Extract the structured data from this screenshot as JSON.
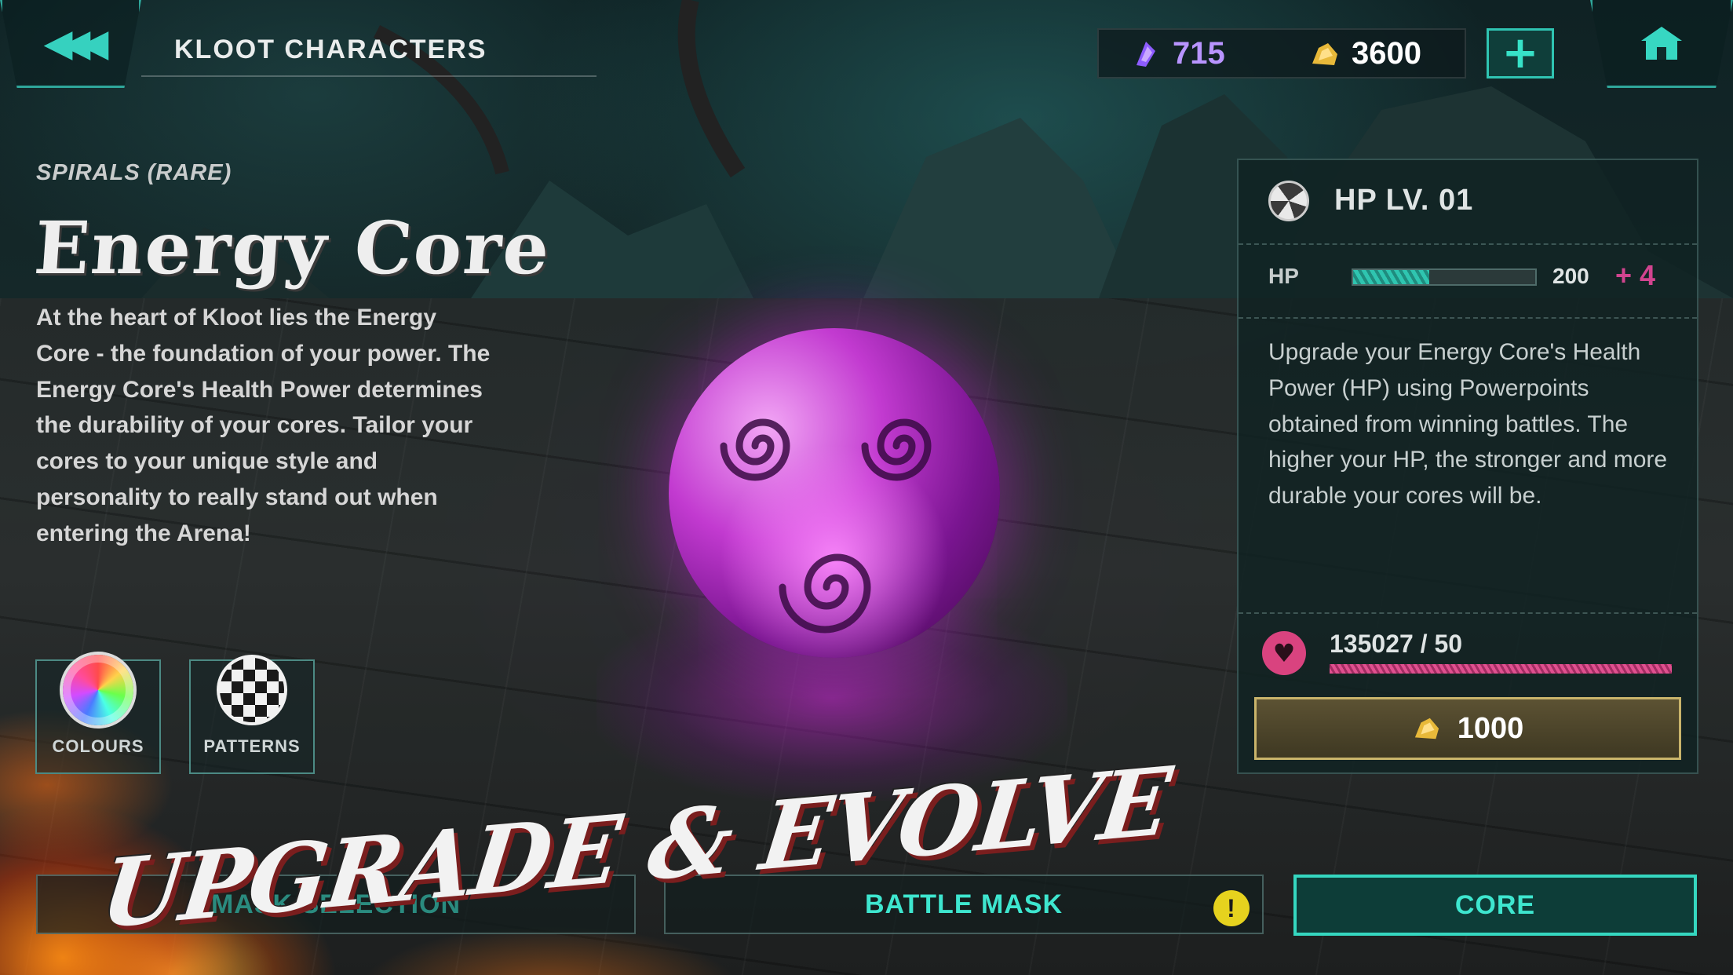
{
  "header": {
    "back_icon": "triple-chevron-left-icon",
    "title": "KLOOT CHARACTERS",
    "gems": "715",
    "gold": "3600",
    "add_icon": "plus-icon",
    "home_icon": "home-icon"
  },
  "item": {
    "rarity": "SPIRALS (RARE)",
    "name": "Energy Core",
    "description": "At the heart of Kloot lies the Energy Core - the foundation of your power. The Energy Core's Health Power determines the durability of your cores. Tailor your cores to your unique style and personality to really stand out when entering the Arena!"
  },
  "tools": [
    {
      "label": "COLOURS",
      "icon": "colour-wheel-icon"
    },
    {
      "label": "PATTERNS",
      "icon": "pattern-ball-icon"
    }
  ],
  "upgrade_panel": {
    "level_title": "HP LV. 01",
    "hp_label": "HP",
    "hp_value": "200",
    "hp_bonus": "+ 4",
    "hp_fill_fraction": 0.42,
    "description": "Upgrade your Energy Core's Health Power (HP) using Powerpoints obtained from winning battles. The higher your HP, the stronger and more durable your cores will be.",
    "powerpoints": "135027 / 50",
    "powerpoints_fill_fraction": 1.0,
    "cost": "1000"
  },
  "tabs": {
    "mask_selection": "MASK SELECTION",
    "battle_mask": "BATTLE MASK",
    "core": "CORE"
  },
  "promo_banner": "UPGRADE & EVOLVE",
  "colors": {
    "accent": "#3ee6cf",
    "gem": "#b894ff",
    "gold": "#e8b93a",
    "powerpoint": "#d9437f"
  }
}
